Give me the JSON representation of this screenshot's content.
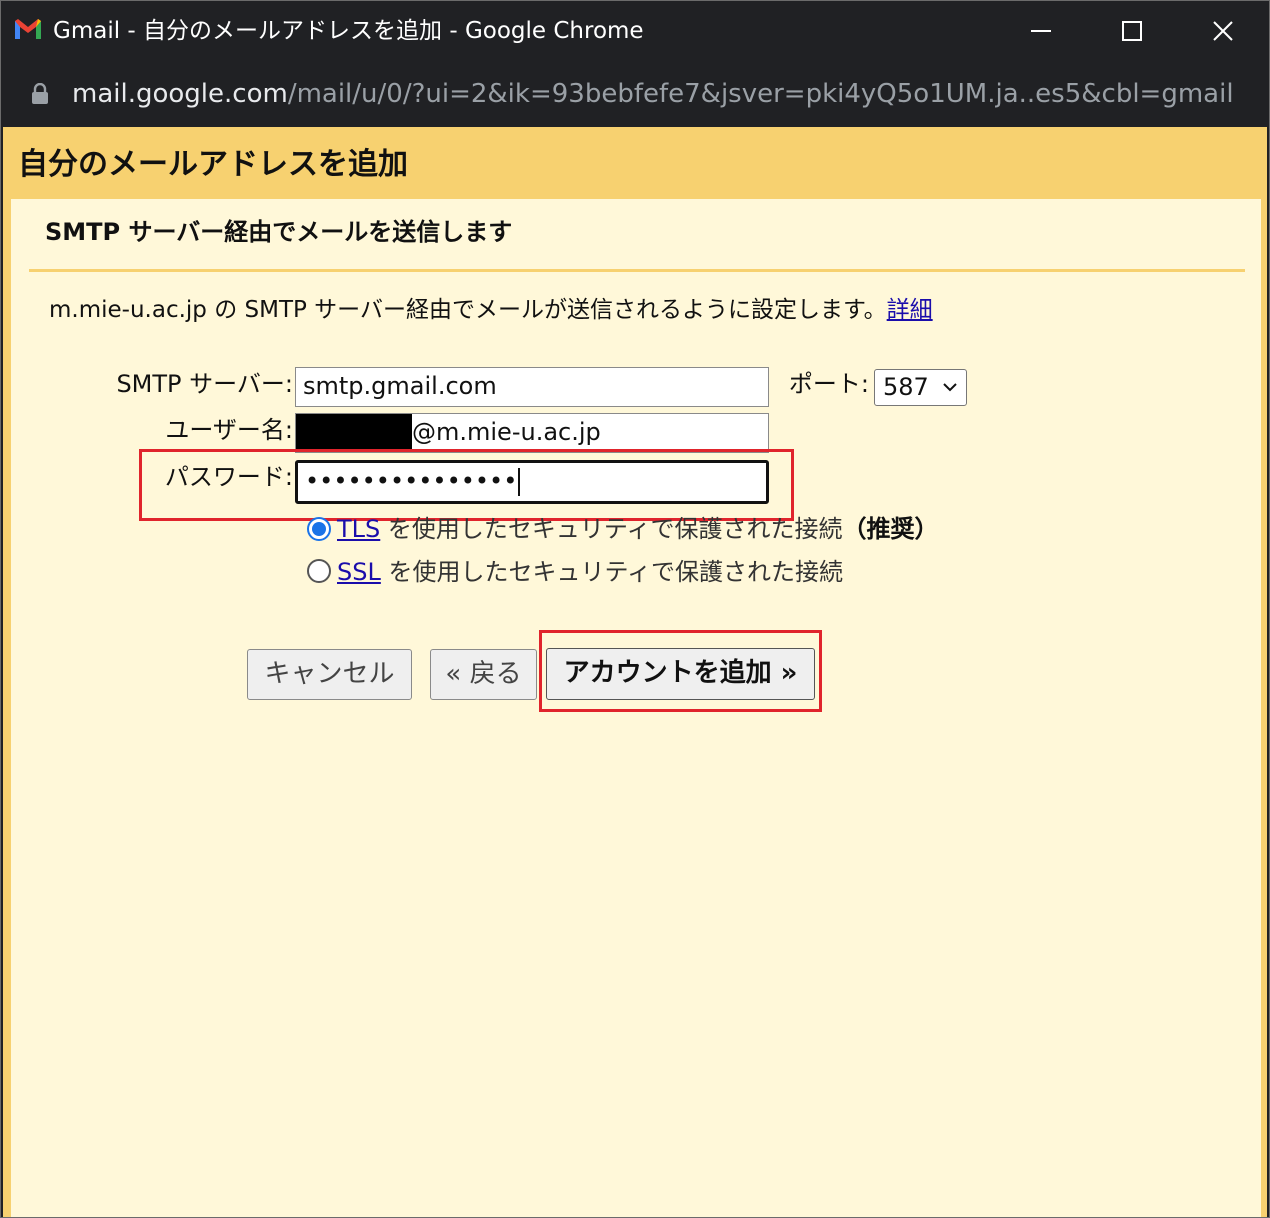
{
  "window": {
    "title": "Gmail - 自分のメールアドレスを追加 - Google Chrome",
    "url_host": "mail.google.com",
    "url_path": "/mail/u/0/?ui=2&ik=93bebfefe7&jsver=pki4yQ5o1UM.ja..es5&cbl=gmail.pi..."
  },
  "page": {
    "title": "自分のメールアドレスを追加",
    "section_title": "SMTP サーバー経由でメールを送信します",
    "description": "m.mie-u.ac.jp の SMTP サーバー経由でメールが送信されるように設定します。",
    "details_link": "詳細"
  },
  "form": {
    "smtp_label": "SMTP サーバー:",
    "smtp_value": "smtp.gmail.com",
    "port_label": "ポート:",
    "port_value": "587",
    "username_label": "ユーザー名:",
    "username_value": "@m.mie-u.ac.jp",
    "password_label": "パスワード:",
    "password_value": "•••••••••••••••",
    "tls_link": "TLS",
    "tls_text": " を使用したセキュリティで保護された接続",
    "tls_recommended": "（推奨）",
    "ssl_link": "SSL",
    "ssl_text": " を使用したセキュリティで保護された接続",
    "tls_selected": true
  },
  "buttons": {
    "cancel": "キャンセル",
    "back": "« 戻る",
    "add_account": "アカウントを追加 »"
  },
  "colors": {
    "header_bg": "#f7d170",
    "content_bg": "#fff8d9",
    "highlight": "#e0242c",
    "link": "#1a0dab",
    "radio": "#1a73e8"
  }
}
